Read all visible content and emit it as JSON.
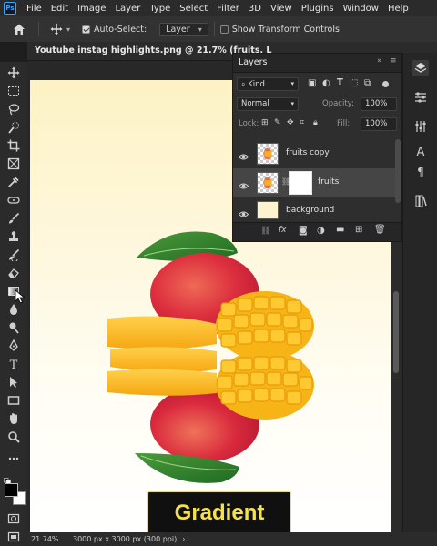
{
  "menubar": {
    "logo": "Ps",
    "items": [
      "File",
      "Edit",
      "Image",
      "Layer",
      "Type",
      "Select",
      "Filter",
      "3D",
      "View",
      "Plugins",
      "Window",
      "Help"
    ]
  },
  "options_bar": {
    "auto_select_label": "Auto-Select:",
    "auto_select_checked": true,
    "auto_select_target": "Layer",
    "show_transform_label": "Show Transform Controls",
    "show_transform_checked": false
  },
  "document": {
    "tab_title": "Youtube instag highlights.png @ 21.7% (fruits, L"
  },
  "caption": {
    "text": "Gradient"
  },
  "status": {
    "zoom": "21.74%",
    "doc_info": "3000 px x 3000 px (300 ppi)"
  },
  "layers_panel": {
    "title": "Layers",
    "kind_label": "Kind",
    "blend_mode": "Normal",
    "opacity_label": "Opacity:",
    "opacity_value": "100%",
    "lock_label": "Lock:",
    "fill_label": "Fill:",
    "fill_value": "100%",
    "layers": [
      {
        "name": "fruits copy",
        "visible": true,
        "selected": false
      },
      {
        "name": "fruits",
        "visible": true,
        "selected": true,
        "has_mask": true
      },
      {
        "name": "background",
        "visible": true,
        "selected": false
      }
    ]
  },
  "colors": {
    "ps_blue": "#31a8ff",
    "caption_text": "#f3e24a",
    "caption_bg": "#101010",
    "artboard_top": "#fdf2c5"
  }
}
